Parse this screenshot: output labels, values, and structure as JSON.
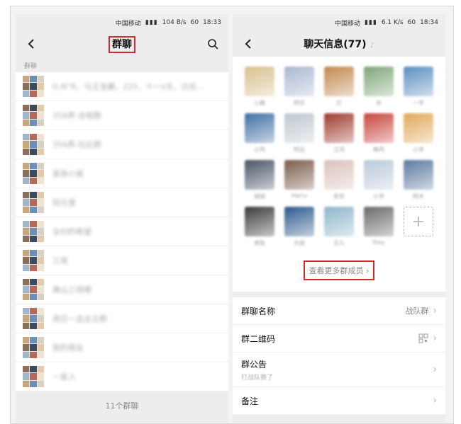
{
  "left": {
    "status": {
      "carrier": "中国移动",
      "time": "18:33",
      "net_speed": "104 B/s",
      "battery": "60"
    },
    "nav": {
      "title": "群聊"
    },
    "section_label": "群聊",
    "groups": [
      {
        "name": "G.N°R、马王宝藏、225、十一x生、比伦..."
      },
      {
        "name": "356弄-合租群"
      },
      {
        "name": "356弄-社区群"
      },
      {
        "name": "家族小屋"
      },
      {
        "name": "阳光里"
      },
      {
        "name": "全村的希望"
      },
      {
        "name": "三哥"
      },
      {
        "name": "佛山三排楼"
      },
      {
        "name": "周日一品全主群"
      },
      {
        "name": "我的朋友"
      },
      {
        "name": "一家人"
      }
    ],
    "count_label": "11个群聊"
  },
  "right": {
    "status": {
      "carrier": "中国移动",
      "time": "18:34",
      "net_speed": "6.1 K/s",
      "battery": "60"
    },
    "nav": {
      "title": "聊天信息(77)"
    },
    "members": [
      {
        "name": "小鹿"
      },
      {
        "name": "阿乐"
      },
      {
        "name": "灯"
      },
      {
        "name": "米"
      },
      {
        "name": "一字"
      },
      {
        "name": "小风"
      },
      {
        "name": "阿远"
      },
      {
        "name": "江河"
      },
      {
        "name": "晚风"
      },
      {
        "name": "小羊"
      },
      {
        "name": "胡胡"
      },
      {
        "name": "Herry"
      },
      {
        "name": "安安"
      },
      {
        "name": "小宇"
      },
      {
        "name": "阿木"
      },
      {
        "name": "老陈"
      },
      {
        "name": "大叔"
      },
      {
        "name": "王九"
      },
      {
        "name": "Stay"
      }
    ],
    "view_more": "查看更多群成员 ›",
    "settings": {
      "group_name_label": "群聊名称",
      "group_name_value": "战队群",
      "qr_label": "群二维码",
      "notice_label": "群公告",
      "notice_text": "打战队赛了",
      "remark_label": "备注"
    }
  },
  "colors": {
    "highlight": "#d32b2b",
    "background": "#ededed"
  }
}
